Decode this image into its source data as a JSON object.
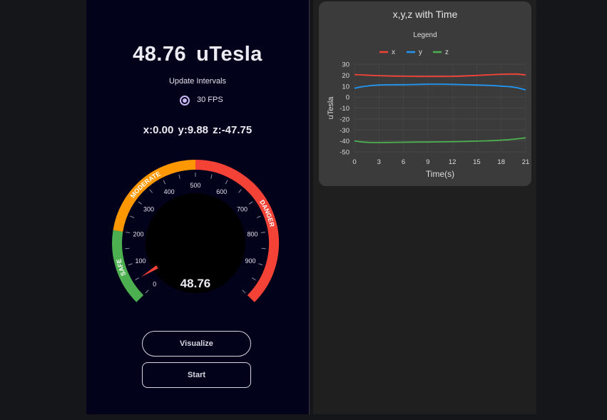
{
  "reading": {
    "value": "48.76",
    "unit": "uTesla"
  },
  "update_intervals": {
    "label": "Update Intervals",
    "option": "30 FPS",
    "selected": true
  },
  "axes_readout": "x:0.00  y:9.88  z:-47.75",
  "gauge": {
    "min": 0,
    "max": 1000,
    "value": 48.76,
    "value_label": "48.76",
    "ticks": [
      "0",
      "100",
      "200",
      "300",
      "400",
      "500",
      "600",
      "700",
      "800",
      "900"
    ],
    "bands": [
      {
        "label": "SAFE",
        "from": 0,
        "to": 200,
        "color": "#4caf50"
      },
      {
        "label": "MODERATE",
        "from": 200,
        "to": 500,
        "color": "#ff9800"
      },
      {
        "label": "DANGER",
        "from": 500,
        "to": 1000,
        "color": "#f44336"
      }
    ],
    "needle_color": "#f44336"
  },
  "buttons": {
    "visualize": "Visualize",
    "start": "Start"
  },
  "chart": {
    "title": "x,y,z with Time",
    "legend_title": "Legend",
    "colors": {
      "x": "#f44336",
      "y": "#2196f3",
      "z": "#4caf50"
    }
  },
  "chart_data": {
    "type": "line",
    "title": "x,y,z with Time",
    "xlabel": "Time(s)",
    "ylabel": "uTesla",
    "x_ticks": [
      0,
      3,
      6,
      9,
      12,
      15,
      18,
      21
    ],
    "y_ticks": [
      30,
      20,
      10,
      0,
      -10,
      -20,
      -30,
      -40,
      -50
    ],
    "xlim": [
      0,
      21
    ],
    "ylim": [
      -50,
      30
    ],
    "grid": true,
    "legend": "top-center",
    "x": [
      0,
      1,
      2,
      3,
      4,
      5,
      6,
      7,
      8,
      9,
      10,
      11,
      12,
      13,
      14,
      15,
      16,
      17,
      18,
      19,
      20,
      21
    ],
    "series": [
      {
        "name": "x",
        "values": [
          20.5,
          20.2,
          19.8,
          19.5,
          19.3,
          19.1,
          19.0,
          18.9,
          18.8,
          18.8,
          18.8,
          18.8,
          18.9,
          19.1,
          19.4,
          19.7,
          20.1,
          20.5,
          20.8,
          21.0,
          21.0,
          20.2
        ]
      },
      {
        "name": "y",
        "values": [
          8.0,
          9.5,
          10.5,
          11.0,
          11.2,
          11.3,
          11.3,
          11.4,
          11.6,
          11.8,
          11.8,
          11.7,
          11.6,
          11.4,
          11.2,
          11.0,
          10.8,
          10.5,
          10.0,
          9.5,
          8.5,
          6.5
        ]
      },
      {
        "name": "z",
        "values": [
          -40.0,
          -41.0,
          -41.5,
          -41.5,
          -41.4,
          -41.3,
          -41.2,
          -41.1,
          -41.0,
          -41.0,
          -40.9,
          -40.8,
          -40.7,
          -40.6,
          -40.4,
          -40.2,
          -40.0,
          -39.7,
          -39.3,
          -38.8,
          -38.0,
          -37.2
        ]
      }
    ]
  }
}
